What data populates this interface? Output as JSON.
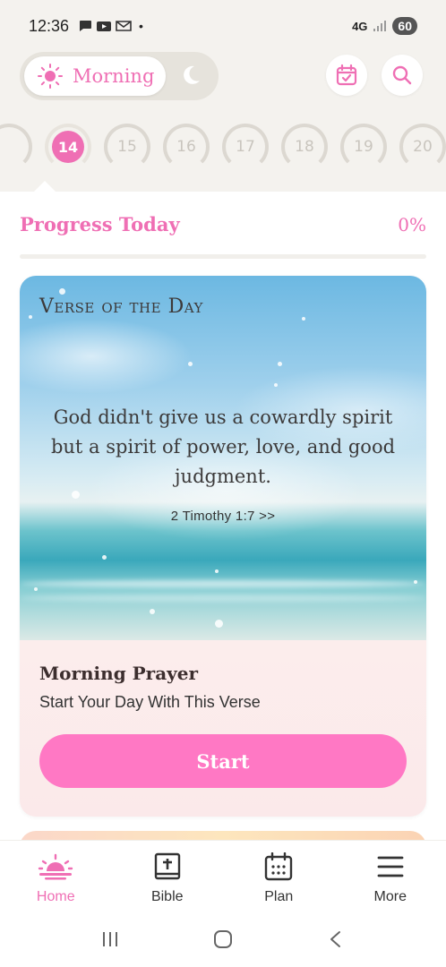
{
  "status_bar": {
    "time": "12:36",
    "network": "4G",
    "battery": "60"
  },
  "header": {
    "mode_label": "Morning",
    "mode_icon": "sun-icon",
    "alt_mode_icon": "moon-icon",
    "calendar_icon": "calendar-check-icon",
    "search_icon": "search-icon"
  },
  "days": [
    {
      "label": "",
      "active": false
    },
    {
      "label": "14",
      "active": true
    },
    {
      "label": "15",
      "active": false
    },
    {
      "label": "16",
      "active": false
    },
    {
      "label": "17",
      "active": false
    },
    {
      "label": "18",
      "active": false
    },
    {
      "label": "19",
      "active": false
    },
    {
      "label": "20",
      "active": false
    }
  ],
  "progress": {
    "title": "Progress Today",
    "percent_label": "0%",
    "fraction": 0
  },
  "verse_card": {
    "heading": "Verse of the Day",
    "text": "God didn't give us a cowardly spirit but a spirit of power, love, and good judgment.",
    "reference": "2 Timothy 1:7 >>",
    "prayer_title": "Morning Prayer",
    "prayer_subtitle": "Start Your Day With This Verse",
    "start_label": "Start"
  },
  "bottom_nav": {
    "items": [
      {
        "label": "Home",
        "icon": "sunrise-icon",
        "active": true
      },
      {
        "label": "Bible",
        "icon": "bible-icon",
        "active": false
      },
      {
        "label": "Plan",
        "icon": "calendar-icon",
        "active": false
      },
      {
        "label": "More",
        "icon": "menu-icon",
        "active": false
      }
    ]
  },
  "colors": {
    "accent": "#ef6fb4",
    "button": "#ff78c4",
    "header_bg": "#f4f2ee"
  }
}
